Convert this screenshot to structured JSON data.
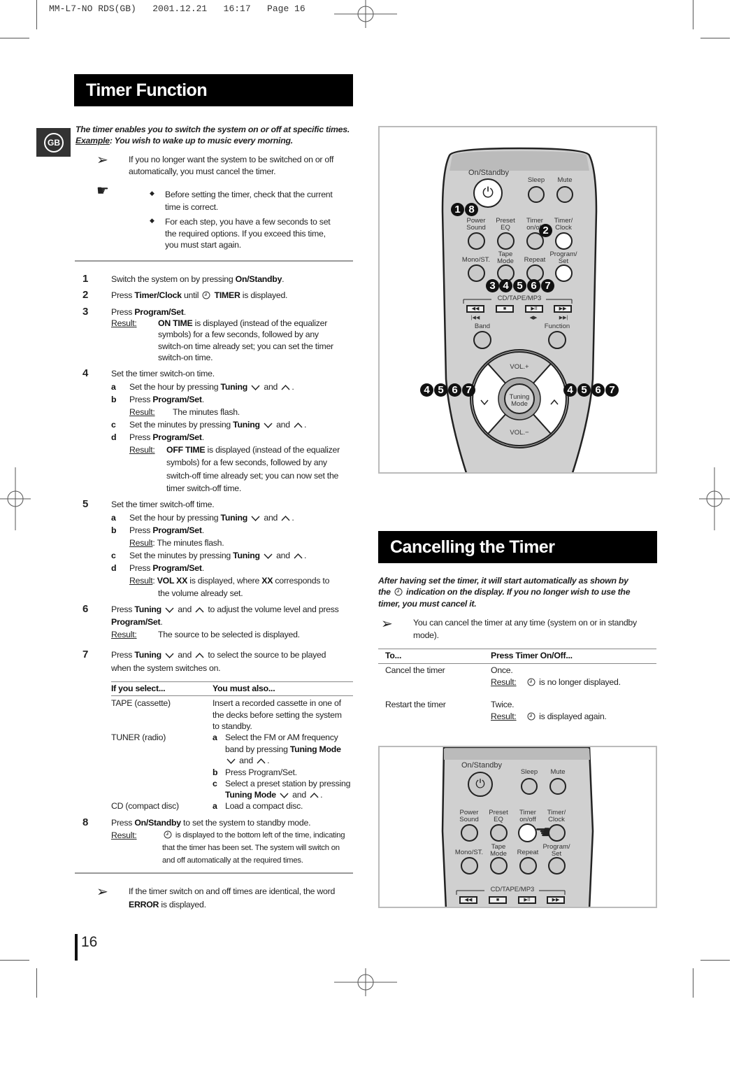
{
  "print_header": "MM-L7-NO RDS(GB)   2001.12.21   16:17   Page 16",
  "language_badge": "GB",
  "page_number": "16",
  "timer_function": {
    "title": "Timer Function",
    "intro_line1": "The timer enables you to switch the system on or off at specific times.",
    "intro_example_label": "Example",
    "intro_example_text": ": You wish to wake up to music every morning.",
    "note1": [
      "If you no longer want the system to be switched on or off",
      "automatically, you must cancel the timer."
    ],
    "bullets": [
      [
        "Before setting the timer, check that the current",
        "time is correct."
      ],
      [
        "For each step, you have a few seconds to set",
        "the required options. If you exceed this time,",
        "you must start again."
      ]
    ],
    "result_label": "Result",
    "steps": {
      "s1": {
        "num": "1",
        "line": [
          "Switch the system on by pressing ",
          {
            "b": "On/Standby"
          },
          "."
        ]
      },
      "s2": {
        "num": "2",
        "line": [
          "Press ",
          {
            "b": "Timer/Clock"
          },
          " until ",
          {
            "icon": "clock"
          },
          " ",
          {
            "b": "TIMER"
          },
          " is displayed."
        ]
      },
      "s3": {
        "num": "3",
        "line": [
          "Press ",
          {
            "b": "Program/Set"
          },
          "."
        ],
        "result": [
          [
            {
              "b": "ON TIME"
            },
            " is displayed (instead of the equalizer"
          ],
          [
            "symbols) for a few seconds, followed by any"
          ],
          [
            "switch-on time already set; you can set the timer"
          ],
          [
            "switch-on time."
          ]
        ]
      },
      "s4": {
        "num": "4",
        "line": [
          "Set the timer switch-on time."
        ],
        "a": [
          "Set the hour by pressing ",
          {
            "b": "Tuning"
          },
          " ",
          {
            "icon": "down"
          },
          " and ",
          {
            "icon": "up"
          },
          "."
        ],
        "b": [
          "Press ",
          {
            "b": "Program/Set"
          },
          "."
        ],
        "b_result": [
          "The minutes flash."
        ],
        "c": [
          "Set the minutes by pressing ",
          {
            "b": "Tuning"
          },
          " ",
          {
            "icon": "down"
          },
          " and ",
          {
            "icon": "up"
          },
          "."
        ],
        "d": [
          "Press ",
          {
            "b": "Program/Set"
          },
          "."
        ],
        "d_result": [
          [
            {
              "b": "OFF TIME"
            },
            " is displayed (instead of the equalizer"
          ],
          [
            "symbols) for a few seconds, followed by any"
          ],
          [
            "switch-off time already set; you can now set the"
          ],
          [
            "timer switch-off time."
          ]
        ]
      },
      "s5": {
        "num": "5",
        "line": [
          "Set the timer switch-off time."
        ],
        "a": [
          "Set the hour by pressing ",
          {
            "b": "Tuning"
          },
          " ",
          {
            "icon": "down"
          },
          " and ",
          {
            "icon": "up"
          },
          "."
        ],
        "b": [
          "Press ",
          {
            "b": "Program/Set"
          },
          "."
        ],
        "b_result": [
          ": The minutes flash."
        ],
        "c": [
          "Set the minutes by pressing ",
          {
            "b": "Tuning"
          },
          " ",
          {
            "icon": "down"
          },
          " and ",
          {
            "icon": "up"
          },
          "."
        ],
        "d": [
          "Press ",
          {
            "b": "Program/Set"
          },
          "."
        ],
        "d_result": [
          [
            ": ",
            {
              "b": "VOL XX"
            },
            " is displayed, where ",
            {
              "b": "XX"
            },
            " corresponds to"
          ],
          [
            "the volume already set."
          ]
        ]
      },
      "s6": {
        "num": "6",
        "lines": [
          [
            "Press ",
            {
              "b": "Tuning"
            },
            " ",
            {
              "icon": "down"
            },
            " and ",
            {
              "icon": "up"
            },
            " to adjust the volume level and press"
          ],
          [
            {
              "b": "Program/Set"
            },
            "."
          ]
        ],
        "result": [
          "The source to be selected is displayed."
        ]
      },
      "s7": {
        "num": "7",
        "lines": [
          [
            "Press ",
            {
              "b": "Tuning"
            },
            " ",
            {
              "icon": "down"
            },
            " and ",
            {
              "icon": "up"
            },
            " to select the source to be played"
          ],
          [
            "when the system switches on."
          ]
        ]
      },
      "s8": {
        "num": "8",
        "line": [
          "Press ",
          {
            "b": "On/Standby"
          },
          " to set the system to standby mode."
        ],
        "result": [
          [
            {
              "icon": "clock"
            },
            " is displayed to the bottom left of the time, indicating"
          ],
          [
            "that the timer has been set. The system will switch on"
          ],
          [
            "and off automatically at the required times."
          ]
        ]
      }
    },
    "source_table": {
      "headers": [
        "If you select...",
        "You must also..."
      ],
      "tape": {
        "label": "TAPE (cassette)",
        "lines": [
          "Insert a recorded cassette in one of",
          "the decks before setting the system",
          "to standby."
        ]
      },
      "tuner": {
        "label": "TUNER (radio)",
        "a": [
          [
            "Select the FM or AM frequency"
          ],
          [
            "band by pressing ",
            {
              "b": "Tuning Mode"
            }
          ],
          [
            {
              "icon": "down"
            },
            " and ",
            {
              "icon": "up"
            },
            "."
          ]
        ],
        "b": [
          "Press Program/Set."
        ],
        "c": [
          [
            "Select a preset station by pressing"
          ],
          [
            {
              "b": "Tuning Mode"
            },
            " ",
            {
              "icon": "down"
            },
            " and ",
            {
              "icon": "up"
            },
            "."
          ]
        ]
      },
      "cd": {
        "label": "CD (compact disc)",
        "a": [
          "Load a compact disc."
        ]
      }
    },
    "note_end": [
      [
        "If the timer switch on and off times are identical, the word"
      ],
      [
        {
          "b": "ERROR"
        },
        " is displayed."
      ]
    ]
  },
  "cancelling": {
    "title": "Cancelling the Timer",
    "intro": [
      [
        "After having set the timer, it will start automatically as shown by"
      ],
      [
        "the ",
        {
          "icon": "clock"
        },
        " indication on the display. If you no longer wish to use the"
      ],
      [
        "timer, you must cancel it."
      ]
    ],
    "note": [
      "You can cancel the timer at any time (system on or in standby",
      "mode)."
    ],
    "table": {
      "headers": [
        "To...",
        "Press Timer On/Off..."
      ],
      "rows": [
        {
          "action": "Cancel the timer",
          "press": "Once.",
          "result": [
            {
              "icon": "clock"
            },
            "  is no longer displayed."
          ]
        },
        {
          "action": "Restart the timer",
          "press": "Twice.",
          "result": [
            {
              "icon": "clock"
            },
            "  is displayed again."
          ]
        }
      ]
    }
  },
  "remote": {
    "on_standby": "On/Standby",
    "sleep": "Sleep",
    "mute": "Mute",
    "power_sound": [
      "Power",
      "Sound"
    ],
    "preset_eq": [
      "Preset",
      "EQ"
    ],
    "timer_onoff": [
      "Timer",
      "on/off"
    ],
    "timer_clock": [
      "Timer/",
      "Clock"
    ],
    "mono_st": "Mono/ST.",
    "tape_mode": [
      "Tape",
      "Mode"
    ],
    "repeat": "Repeat",
    "program_set": [
      "Program/",
      "Set"
    ],
    "cd_tape_mp3": "CD/TAPE/MP3",
    "band": "Band",
    "function": "Function",
    "vol_plus": "VOL.+",
    "vol_minus": "VOL.−",
    "tuning_mode": [
      "Tuning",
      "Mode"
    ],
    "callouts": {
      "power": [
        "1",
        "8"
      ],
      "timer_clock": [
        "2"
      ],
      "program_set": [
        "3",
        "4",
        "5",
        "6",
        "7"
      ],
      "tuning_down": [
        "4",
        "5",
        "6",
        "7"
      ],
      "tuning_up": [
        "4",
        "5",
        "6",
        "7"
      ]
    }
  },
  "colors": {
    "header_bg": "#000000",
    "remote_body": "#c8c8c8",
    "highlight_button": "#ffffff"
  }
}
